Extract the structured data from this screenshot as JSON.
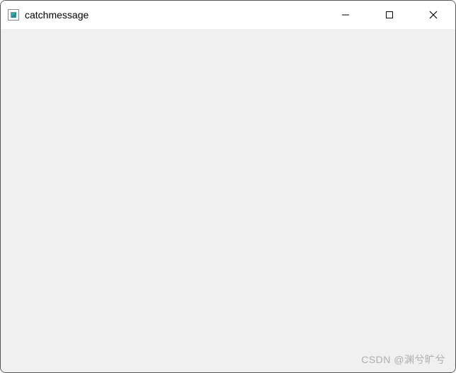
{
  "window": {
    "title": "catchmessage"
  },
  "watermark": {
    "text": "CSDN @渊兮旷兮"
  }
}
